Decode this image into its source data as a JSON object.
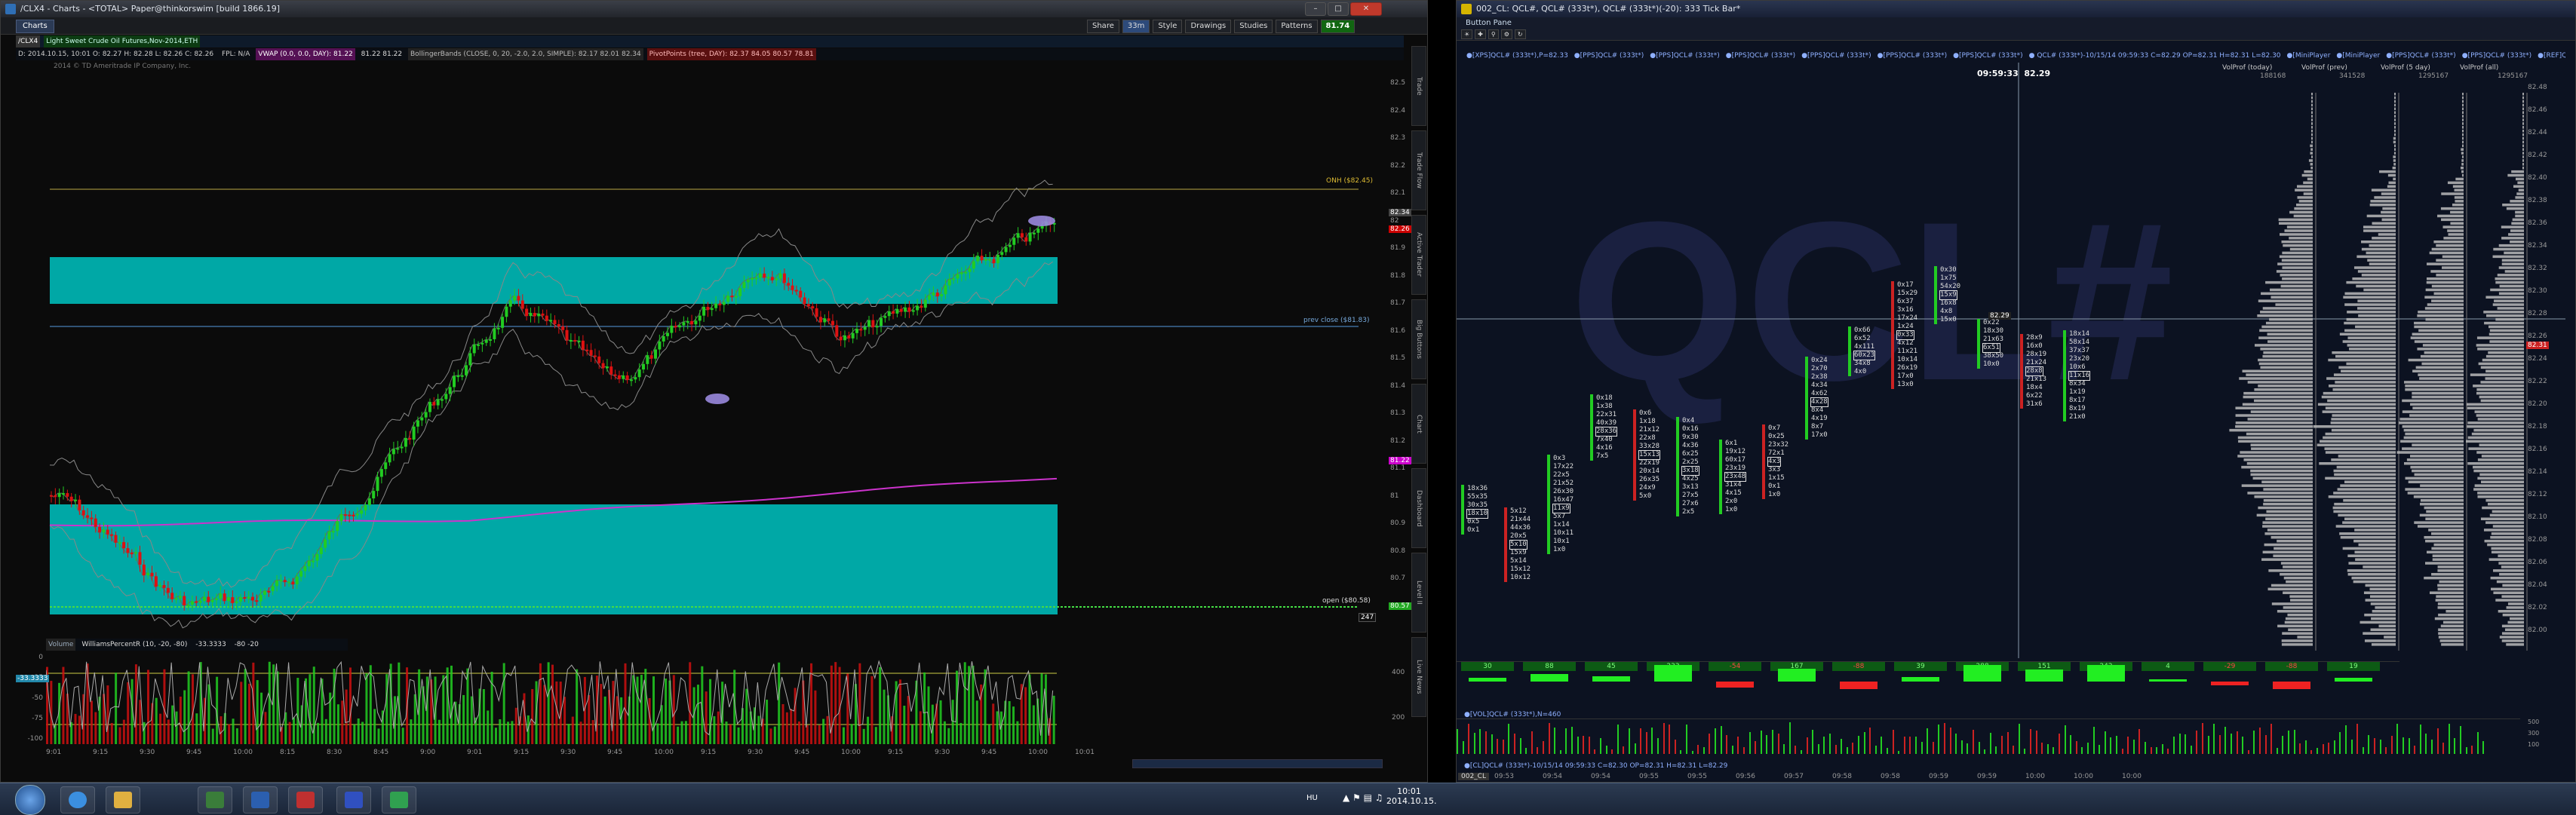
{
  "left": {
    "title": "/CLX4 - Charts - <TOTAL> Paper@thinkorswim [build 1866.19]",
    "tab_label": "Charts",
    "symbol": "/CLX4",
    "toolbar": [
      "Share",
      "Style",
      "Drawings",
      "Studies",
      "Patterns"
    ],
    "zoom_badge": "33m",
    "last_price": "81.74",
    "desc": "Light Sweet Crude Oil Futures,Nov-2014,ETH",
    "quote_line": "D: 2014.10.15, 10:01  O: 82.27  H: 82.28  L: 82.26  C: 82.26",
    "studies_line": [
      "FPL: N/A",
      "VWAP (0.0, 0.0, DAY): 81.22",
      "81.22  81.22",
      "BollingerBands (CLOSE, 0, 20, -2.0, 2.0, SIMPLE): 82.17  82.01  82.34",
      "PivotPoints (tree, DAY): 82.37  84.05  80.57  78.81"
    ],
    "copyright": "2014 © TD Ameritrade IP Company, Inc.",
    "onh_label": "ONH ($82.45)",
    "prevclose_label": "prev close ($81.83)",
    "open_label": "open ($80.58)",
    "price_ticks": [
      "82.5",
      "82.4",
      "82.3",
      "82.2",
      "82.1",
      "82",
      "81.9",
      "81.8",
      "81.7",
      "81.6",
      "81.5",
      "81.4",
      "81.3",
      "81.2",
      "81.1",
      "81",
      "80.9",
      "80.8",
      "80.7",
      "80.6"
    ],
    "price_tags": [
      {
        "text": "82.34",
        "bg": "#444"
      },
      {
        "text": "82.26",
        "bg": "#cc0000"
      },
      {
        "text": "81.22",
        "bg": "#cc00cc"
      },
      {
        "text": "80.57",
        "bg": "#22aa22"
      }
    ],
    "bars_count": "247",
    "volume_label": "Volume",
    "wpr_label": "WilliamsPercentR (10, -20, -80)",
    "wpr_value": "-33.3333",
    "wpr_levels": "-80  -20",
    "wpr_ticks": [
      "0",
      "-25",
      "-50",
      "-75",
      "-100"
    ],
    "vol_ticks": [
      "400",
      "200"
    ],
    "time_ticks": [
      "9:01",
      "9:15",
      "9:30",
      "9:45",
      "10:00",
      "8:15",
      "8:30",
      "8:45",
      "9:00",
      "9:01",
      "9:15",
      "9:30",
      "9:45",
      "10:00",
      "9:15",
      "9:30",
      "9:45",
      "10:00",
      "9:15",
      "9:30",
      "9:45",
      "10:00",
      "10:01"
    ],
    "vtabs": [
      "Trade",
      "Trade Flow",
      "Active Trader",
      "Big Buttons",
      "Chart",
      "Dashboard",
      "Level II",
      "Live News"
    ]
  },
  "right": {
    "title": "002_CL: QCL#, QCL# (333t*), QCL# (333t*)(-20): 333 Tick Bar*",
    "menu_label": "Button Pane",
    "indicators": [
      "●[XPS]QCL# (333t*),P=82.33",
      "●[PPS]QCL# (333t*)",
      "●[PPS]QCL# (333t*)",
      "●[PPS]QCL# (333t*)",
      "●[PPS]QCL# (333t*)",
      "●[PPS]QCL# (333t*)",
      "●[PPS]QCL# (333t*)",
      "● QCL# (333t*)-10/15/14 09:59:33 C=82.29 OP=82.31 H=82.31 L=82.30",
      "●[MiniPlayer",
      "●[MiniPlayer",
      "●[PPS]QCL# (333t*)",
      "●[PPS]QCL# (333t*)",
      "●[REF]QCL# (333t*) FB=0.06",
      "●[REF]QCL# (333t*)"
    ],
    "crosshair_time": "09:59:33",
    "crosshair_price": "82.29",
    "crosshair_tag": "82.29",
    "vp_headers": [
      "VolProf (today)",
      "VolProf (prev)",
      "VolProf (5 day)",
      "VolProf (all)"
    ],
    "vp_values": [
      "188168",
      "341528",
      "1295167",
      "1295167"
    ],
    "price_ticks": [
      "82.48",
      "82.46",
      "82.44",
      "82.42",
      "82.40",
      "82.38",
      "82.36",
      "82.34",
      "82.32",
      "82.30",
      "82.28",
      "82.26",
      "82.24",
      "82.22",
      "82.20",
      "82.18",
      "82.16",
      "82.14",
      "82.12",
      "82.10",
      "82.08",
      "82.06",
      "82.04",
      "82.02",
      "82.00"
    ],
    "price_tag": "82.31",
    "delta_values": [
      "30",
      "88",
      "45",
      "233",
      "-54",
      "167",
      "-88",
      "39",
      "288",
      "151",
      "242",
      "4",
      "-29",
      "-88",
      "19"
    ],
    "vol_label": "●[VOL]QCL# (333t*),N=460",
    "vol_ticks": [
      "500",
      "300",
      "100"
    ],
    "lower_label": "●[CL]QCL# (333t*)-10/15/14 09:59:33 C=82.30 OP=82.31 H=82.31 L=82.29",
    "lower_ticks": [
      "3",
      "2",
      "1"
    ],
    "time_ticks": [
      "09:53",
      "09:54",
      "09:54",
      "09:55",
      "09:55",
      "09:56",
      "09:57",
      "09:58",
      "09:58",
      "09:59",
      "09:59",
      "10:00",
      "10:00",
      "10:00"
    ],
    "footer_tab": "002_CL",
    "footprints": [
      {
        "col": 0,
        "rows": [
          "18x36",
          "55x35",
          "30x35",
          "18x10",
          "0x5",
          "0x1"
        ]
      },
      {
        "col": 1,
        "rows": [
          "5x12",
          "21x44",
          "44x36",
          "20x5",
          "5x10",
          "15x9",
          "5x14",
          "15x12",
          "10x12"
        ]
      },
      {
        "col": 2,
        "rows": [
          "0x3",
          "17x22",
          "22x5",
          "21x52",
          "26x30",
          "16x47",
          "11x9",
          "5x7",
          "1x14",
          "10x11",
          "10x1",
          "1x0"
        ]
      },
      {
        "col": 3,
        "rows": [
          "0x18",
          "1x38",
          "22x31",
          "40x39",
          "28x36",
          "7x40",
          "4x16",
          "7x5"
        ]
      },
      {
        "col": 4,
        "rows": [
          "0x6",
          "1x18",
          "21x12",
          "22x8",
          "33x28",
          "15x13",
          "22x19",
          "20x14",
          "26x35",
          "24x9",
          "5x0"
        ]
      },
      {
        "col": 5,
        "rows": [
          "0x4",
          "0x16",
          "9x30",
          "4x36",
          "6x25",
          "2x25",
          "3x18",
          "4x25",
          "3x13",
          "27x5",
          "27x6",
          "2x5"
        ]
      },
      {
        "col": 6,
        "rows": [
          "6x1",
          "19x12",
          "60x17",
          "23x19",
          "23x48",
          "31x4",
          "4x15",
          "2x0",
          "1x0"
        ]
      },
      {
        "col": 7,
        "rows": [
          "0x7",
          "0x25",
          "23x32",
          "72x1",
          "4x3",
          "3x3",
          "1x15",
          "0x1",
          "1x0"
        ]
      },
      {
        "col": 8,
        "rows": [
          "0x24",
          "2x70",
          "2x38",
          "4x34",
          "4x62",
          "4x28",
          "8x4",
          "4x19",
          "8x7",
          "17x0"
        ]
      },
      {
        "col": 9,
        "rows": [
          "0x66",
          "6x52",
          "4x111",
          "60x23",
          "34x8",
          "4x0"
        ]
      },
      {
        "col": 10,
        "rows": [
          "0x17",
          "15x29",
          "6x37",
          "3x16",
          "17x24",
          "1x24",
          "0x33",
          "4x12",
          "11x21",
          "10x14",
          "26x19",
          "17x0",
          "13x0"
        ]
      },
      {
        "col": 11,
        "rows": [
          "0x30",
          "1x75",
          "54x20",
          "15x9",
          "16x8",
          "4x8",
          "15x0"
        ]
      },
      {
        "col": 12,
        "rows": [
          "0x22",
          "18x30",
          "21x63",
          "6x51",
          "38x50",
          "10x0"
        ]
      },
      {
        "col": 13,
        "rows": [
          "28x9",
          "16x0",
          "28x19",
          "21x24",
          "28x8",
          "21x13",
          "18x4",
          "6x22",
          "31x6"
        ]
      },
      {
        "col": 14,
        "rows": [
          "18x14",
          "58x14",
          "37x37",
          "23x20",
          "10x6",
          "11x16",
          "8x34",
          "1x19",
          "8x17",
          "8x19",
          "21x0"
        ]
      }
    ]
  },
  "taskbar": {
    "lang": "HU",
    "time": "10:01",
    "date": "2014.10.15.",
    "apps": [
      "start",
      "ie",
      "explorer",
      "tos",
      "word",
      "pdf",
      "ninja",
      "app"
    ]
  },
  "colors": {
    "teal_zone": "#00aaa8",
    "up_bar": "#22cc22",
    "down_bar": "#dd1111",
    "vwap": "#cc33cc",
    "bg_right": "#0c1221"
  }
}
